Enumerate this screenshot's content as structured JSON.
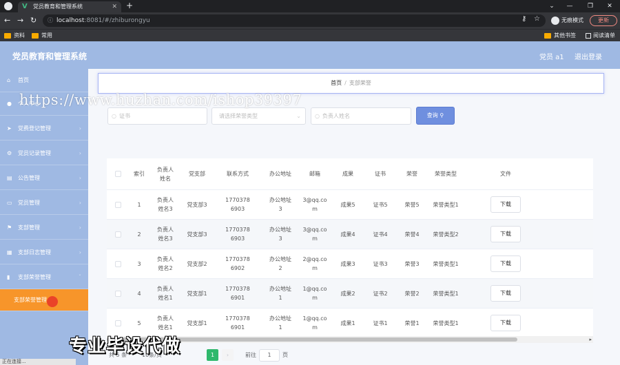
{
  "browser": {
    "tab_title": "党员教育和管理系统",
    "url_host": "localhost",
    "url_path": ":8081/#/zhiburongyu",
    "incognito_label": "无痕模式",
    "update_label": "更新",
    "bookmarks": [
      "资料",
      "常用"
    ],
    "bookmarks_right": [
      "其他书签",
      "阅读清单"
    ]
  },
  "header": {
    "title": "党员教育和管理系统",
    "user": "党员 a1",
    "logout": "退出登录"
  },
  "sidebar": {
    "items": [
      {
        "label": "首页",
        "icon": "home-icon"
      },
      {
        "label": "个人中心",
        "icon": "user-icon"
      },
      {
        "label": "党费登记管理",
        "icon": "send-icon"
      },
      {
        "label": "党员记录管理",
        "icon": "gear-icon"
      },
      {
        "label": "公告管理",
        "icon": "notice-icon"
      },
      {
        "label": "党员管理",
        "icon": "card-icon"
      },
      {
        "label": "支部管理",
        "icon": "flag-icon"
      },
      {
        "label": "支部日志管理",
        "icon": "log-icon"
      },
      {
        "label": "支部荣誉管理",
        "icon": "chart-icon"
      },
      {
        "label": "支部荣誉管理"
      }
    ]
  },
  "breadcrumb": {
    "home": "首页",
    "separator": "/",
    "current": "支部荣誉"
  },
  "search": {
    "cert_placeholder": "证书",
    "type_placeholder": "请选择荣誉类型",
    "leader_placeholder": "负责人姓名",
    "button_label": "查询"
  },
  "table": {
    "headers": [
      "索引",
      "负责人姓名",
      "党支部",
      "联系方式",
      "办公地址",
      "邮箱",
      "成果",
      "证书",
      "荣誉",
      "荣誉类型",
      "文件"
    ],
    "download_label": "下载",
    "rows": [
      [
        "1",
        "负责人姓名3",
        "党支部3",
        "17703786903",
        "办公地址3",
        "3@qq.com",
        "成果5",
        "证书5",
        "荣誉5",
        "荣誉类型1"
      ],
      [
        "2",
        "负责人姓名3",
        "党支部3",
        "17703786903",
        "办公地址3",
        "3@qq.com",
        "成果4",
        "证书4",
        "荣誉4",
        "荣誉类型2"
      ],
      [
        "3",
        "负责人姓名2",
        "党支部2",
        "17703786902",
        "办公地址2",
        "2@qq.com",
        "成果3",
        "证书3",
        "荣誉3",
        "荣誉类型1"
      ],
      [
        "4",
        "负责人姓名1",
        "党支部1",
        "17703786901",
        "办公地址1",
        "1@qq.com",
        "成果2",
        "证书2",
        "荣誉2",
        "荣誉类型1"
      ],
      [
        "5",
        "负责人姓名1",
        "党支部1",
        "17703786901",
        "办公地址1",
        "1@qq.com",
        "成果1",
        "证书1",
        "荣誉1",
        "荣誉类型1"
      ]
    ]
  },
  "pagination": {
    "total": "共 5 条",
    "page_size": "10条/页",
    "current_page": "1",
    "goto_label": "前往",
    "goto_value": "1",
    "page_suffix": "页"
  },
  "status_text": "正在连接...",
  "overlay": {
    "watermark": "https://www.huzhan.com/ishop39397",
    "promo": "专业毕设代做"
  },
  "colors": {
    "sidebar": "#9fb9e3",
    "active_menu": "#f7952a",
    "search_button": "#6f8fdf",
    "pager_active": "#2fb86c"
  }
}
